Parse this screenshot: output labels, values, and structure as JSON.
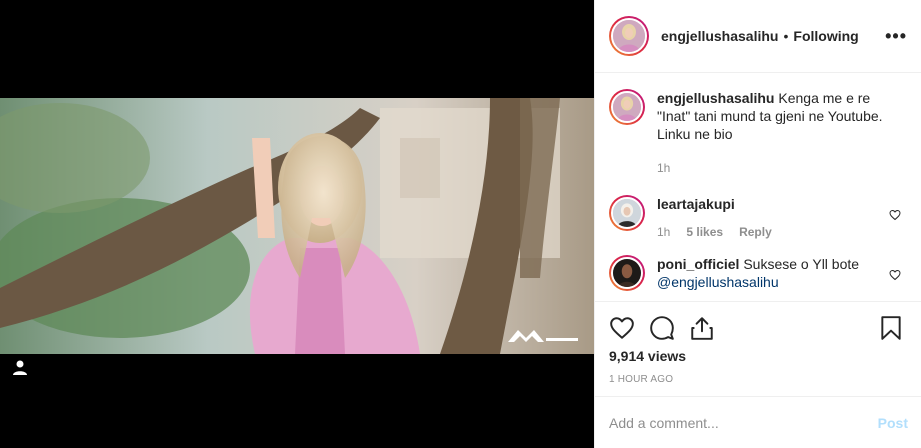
{
  "post": {
    "username": "engjellushasalihu",
    "separator": "•",
    "follow_status": "Following",
    "more_label": "•••"
  },
  "caption": {
    "username": "engjellushasalihu",
    "text": "Kenga me e re \"Inat\" tani mund ta gjeni ne Youtube. Linku ne bio",
    "emoji": "",
    "time": "1h"
  },
  "comments": [
    {
      "username": "leartajakupi",
      "text": "",
      "time": "1h",
      "likes": "5 likes",
      "reply": "Reply"
    },
    {
      "username": "poni_officiel",
      "text": "Suksese o Yll bote",
      "mention": "@engjellushasalihu",
      "emoji": ""
    }
  ],
  "stats": {
    "views": "9,914 views",
    "posted": "1 HOUR AGO"
  },
  "comment_box": {
    "placeholder": "Add a comment...",
    "post_label": "Post"
  },
  "icons": {
    "like": "heart-icon",
    "comment": "comment-bubble-icon",
    "share": "share-icon",
    "save": "bookmark-icon",
    "user_tag": "user-tag-icon"
  },
  "colors": {
    "accent_disabled": "#b2dffc",
    "muted_text": "#8e8e8e",
    "mention": "#003569",
    "border": "#efefef"
  }
}
